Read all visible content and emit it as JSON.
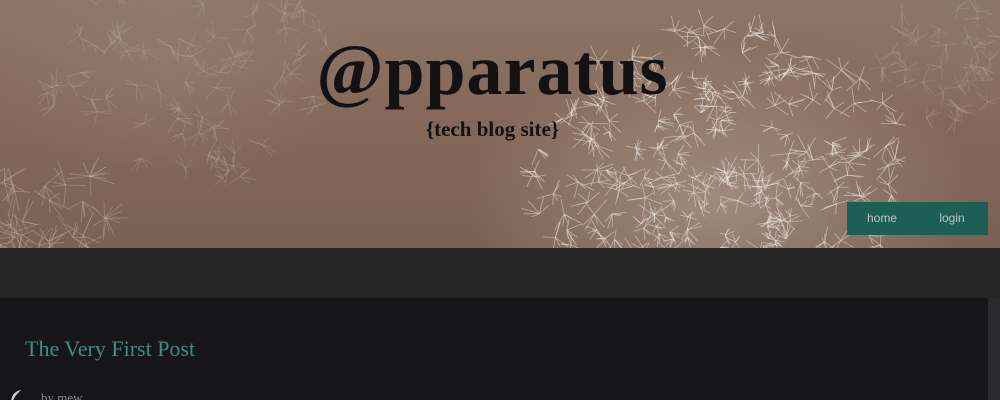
{
  "header": {
    "title": "@pparatus",
    "subtitle": "{tech blog site}",
    "background_image": "cactus-photo"
  },
  "nav": {
    "items": [
      {
        "label": "home"
      },
      {
        "label": "login"
      }
    ]
  },
  "post": {
    "title": "The Very First Post",
    "byline": "by mew",
    "author_icon": "feather-icon"
  },
  "colors": {
    "nav_background": "#1e5f55",
    "post_title": "#3d8d86",
    "band": "#252525",
    "content_background": "#16161a"
  }
}
